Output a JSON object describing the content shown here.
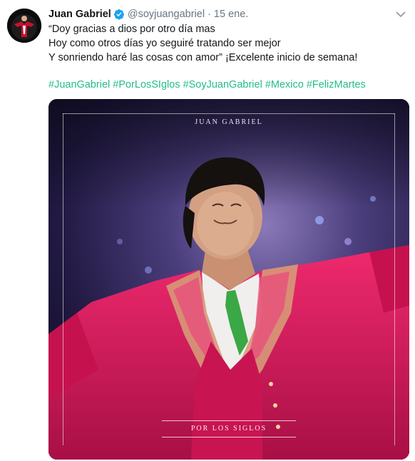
{
  "author": {
    "name": "Juan Gabriel",
    "handle": "@soyjuangabriel",
    "separator": "·",
    "timestamp": "15 ene.",
    "verified": true,
    "avatar_icon": "avatar-photo"
  },
  "tweet": {
    "lines": [
      "“Doy gracias a dios por otro día mas",
      "Hoy como otros días yo seguiré tratando ser mejor",
      "Y sonriendo haré las cosas con amor” ¡Excelente inicio de semana!"
    ],
    "hashtags": [
      "#JuanGabriel",
      "#PorLosSIglos",
      "#SoyJuanGabriel",
      "#Mexico",
      "#FelizMartes"
    ]
  },
  "media": {
    "cover_title": "JUAN GABRIEL",
    "cover_subtitle": "POR LOS SIGLOS"
  },
  "colors": {
    "hashtag": "#22bd8a",
    "verified": "#1da1f2",
    "muted": "#657786"
  }
}
